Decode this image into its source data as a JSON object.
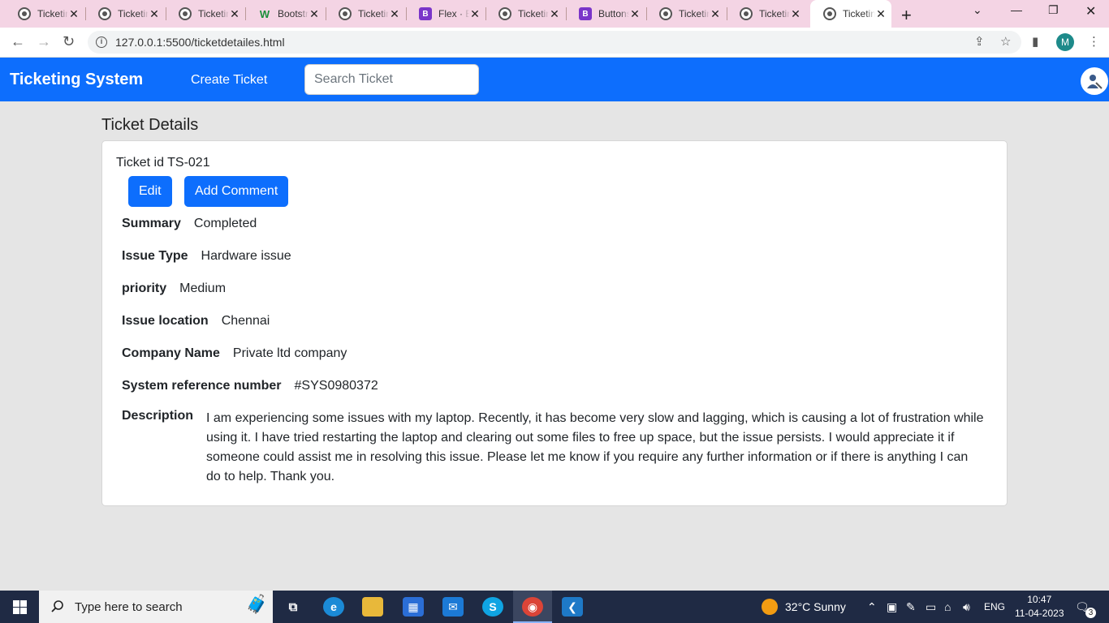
{
  "browser": {
    "tabs": [
      {
        "label": "Ticketing System",
        "icon": "globe-icon"
      },
      {
        "label": "Ticketing System",
        "icon": "globe-icon"
      },
      {
        "label": "Ticketing System",
        "icon": "globe-icon"
      },
      {
        "label": "Bootstrap",
        "icon": "w3schools-icon"
      },
      {
        "label": "Ticketing System",
        "icon": "globe-icon"
      },
      {
        "label": "Flex · Bootstrap",
        "icon": "bootstrap-icon"
      },
      {
        "label": "Ticketing System",
        "icon": "globe-icon"
      },
      {
        "label": "Buttons",
        "icon": "bootstrap-icon"
      },
      {
        "label": "Ticketing System",
        "icon": "globe-icon"
      },
      {
        "label": "Ticketing System",
        "icon": "globe-icon"
      },
      {
        "label": "Ticketing System",
        "icon": "globe-icon",
        "active": true
      }
    ],
    "url": "127.0.0.1:5500/ticketdetailes.html",
    "profile_initial": "M"
  },
  "navbar": {
    "brand": "Ticketing System",
    "create_link": "Create Ticket",
    "search_placeholder": "Search Ticket"
  },
  "page": {
    "title": "Ticket Details",
    "ticket_id": "Ticket id TS-021",
    "buttons": {
      "edit": "Edit",
      "add_comment": "Add Comment"
    },
    "fields": [
      {
        "label": "Summary",
        "value": "Completed"
      },
      {
        "label": "Issue Type",
        "value": "Hardware issue"
      },
      {
        "label": "priority",
        "value": "Medium"
      },
      {
        "label": "Issue location",
        "value": "Chennai"
      },
      {
        "label": "Company Name",
        "value": "Private ltd company"
      },
      {
        "label": "System reference number",
        "value": "#SYS0980372"
      },
      {
        "label": "Description",
        "value": "I am experiencing some issues with my laptop. Recently, it has become very slow and lagging, which is causing a lot of frustration while using it. I have tried restarting the laptop and clearing out some files to free up space, but the issue persists. I would appreciate it if someone could assist me in resolving this issue. Please let me know if you require any further information or if there is anything I can do to help. Thank you."
      }
    ]
  },
  "taskbar": {
    "search_label": "Type here to search",
    "weather": "32°C  Sunny",
    "language": "ENG",
    "time": "10:47",
    "date": "11-04-2023",
    "notifications": "3"
  },
  "colors": {
    "primary": "#0d6efd",
    "tabstrip": "#f4d4e4",
    "taskbar": "#1f2a44"
  }
}
